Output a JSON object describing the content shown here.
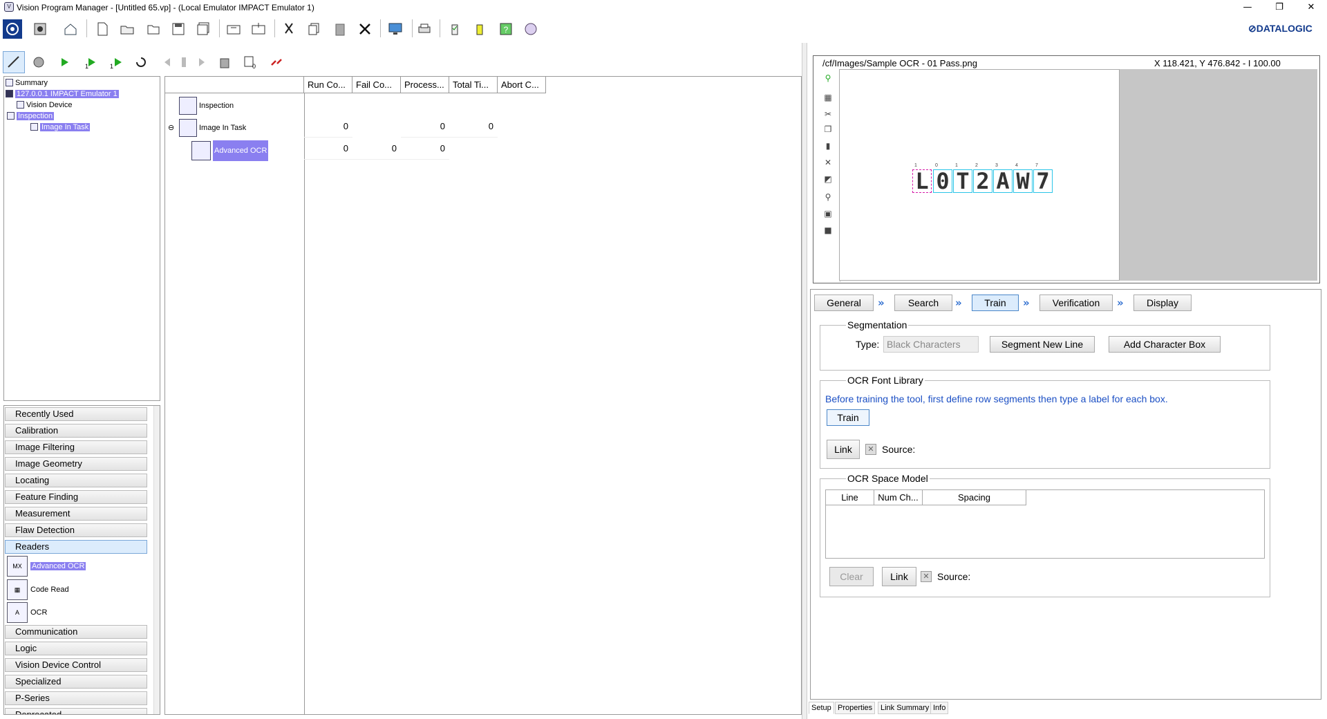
{
  "window": {
    "title": "Vision Program Manager - [Untitled 65.vp] - (Local Emulator IMPACT Emulator 1)",
    "minimize": "—",
    "restore": "❐",
    "close": "✕"
  },
  "brand": "⊘DATALOGIC",
  "tree": {
    "summary": "Summary",
    "emulator": "127.0.0.1 IMPACT Emulator 1",
    "vision_device": "Vision Device",
    "inspection": "Inspection",
    "image_in_task": "Image In Task"
  },
  "palette": {
    "categories_top": [
      "Recently Used",
      "Calibration",
      "Image Filtering",
      "Image Geometry",
      "Locating",
      "Feature Finding",
      "Measurement",
      "Flaw Detection",
      "Readers"
    ],
    "reader_items": [
      "Advanced OCR",
      "Code Read",
      "OCR"
    ],
    "categories_bottom": [
      "Communication",
      "Logic",
      "Vision Device Control",
      "Specialized",
      "P-Series",
      "Deprecated"
    ]
  },
  "grid": {
    "columns": [
      "Run Co...",
      "Fail Co...",
      "Process...",
      "Total Ti...",
      "Abort C..."
    ],
    "rows": [
      {
        "name": "Inspection",
        "values": [
          "",
          "",
          "",
          "",
          ""
        ]
      },
      {
        "name": "Image In Task",
        "values": [
          "0",
          "",
          "0",
          "0",
          ""
        ]
      },
      {
        "name": "Advanced OCR",
        "values": [
          "0",
          "0",
          "0",
          "",
          ""
        ]
      }
    ]
  },
  "image_view": {
    "path": "/cf/Images/Sample OCR - 01 Pass.png",
    "coords": "X 118.421,  Y 476.842  -  I 100.00",
    "ocr_text": [
      "L",
      "0",
      "T",
      "2",
      "A",
      "W",
      "7"
    ],
    "box_labels": [
      "1",
      "0",
      "1",
      "2",
      "3",
      "4",
      "7"
    ]
  },
  "steps": [
    "General",
    "Search",
    "Train",
    "Verification",
    "Display"
  ],
  "segmentation": {
    "title": "Segmentation",
    "type_label": "Type:",
    "type_value": "Black Characters",
    "segment_btn": "Segment New Line",
    "add_box_btn": "Add Character Box"
  },
  "font_library": {
    "title": "OCR Font Library",
    "hint": "Before training the tool, first define row segments then type a label for each box.",
    "train_btn": "Train",
    "link_btn": "Link",
    "source_label": "Source:"
  },
  "space_model": {
    "title": "OCR Space Model",
    "columns": [
      "Line",
      "Num Ch...",
      "Spacing"
    ],
    "clear_btn": "Clear",
    "link_btn": "Link",
    "source_label": "Source:"
  },
  "bottom_tabs": [
    "Setup",
    "Properties",
    "Link Summary",
    "Info"
  ]
}
